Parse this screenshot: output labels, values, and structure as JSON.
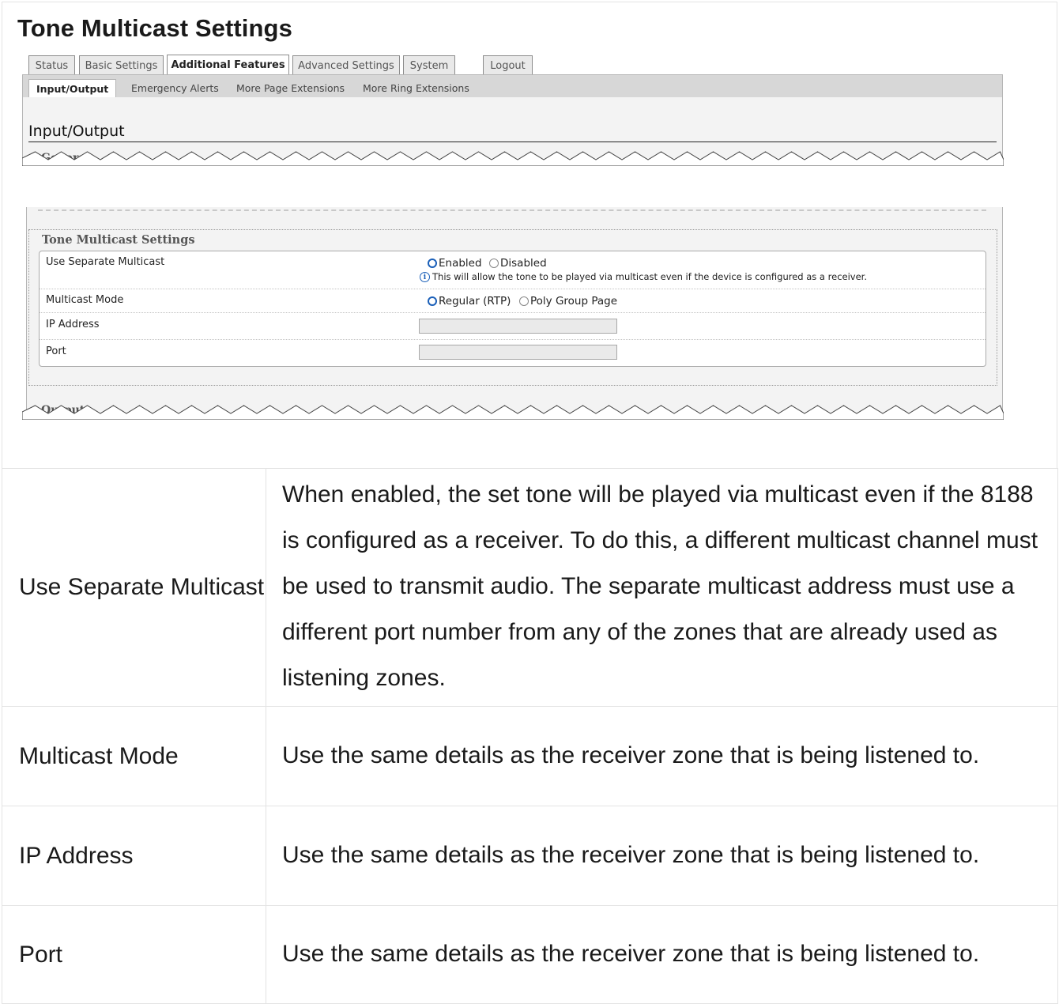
{
  "doc_title": "Tone Multicast Settings",
  "tabs": [
    {
      "label": "Status",
      "active": false
    },
    {
      "label": "Basic Settings",
      "active": false
    },
    {
      "label": "Additional Features",
      "active": true
    },
    {
      "label": "Advanced Settings",
      "active": false
    },
    {
      "label": "System",
      "active": false
    },
    {
      "label": "Logout",
      "active": false
    }
  ],
  "subtabs": [
    {
      "label": "Input/Output",
      "active": true
    },
    {
      "label": "Emergency Alerts",
      "active": false
    },
    {
      "label": "More Page Extensions",
      "active": false
    },
    {
      "label": "More Ring Extensions",
      "active": false
    }
  ],
  "section_title": "Input/Output",
  "general_legend": "General",
  "output_legend": "Output",
  "form": {
    "legend": "Tone Multicast Settings",
    "use_separate_multicast": {
      "label": "Use Separate Multicast",
      "option_enabled": "Enabled",
      "option_disabled": "Disabled",
      "selected": "Enabled",
      "note": "This will allow the tone to be played via multicast even if the device is configured as a receiver."
    },
    "multicast_mode": {
      "label": "Multicast Mode",
      "option_regular": "Regular (RTP)",
      "option_poly": "Poly Group Page",
      "selected": "Regular (RTP)"
    },
    "ip_address": {
      "label": "IP Address",
      "value": ""
    },
    "port": {
      "label": "Port",
      "value": ""
    }
  },
  "descriptions": [
    {
      "field": "Use Separate Multicast",
      "text": "When enabled, the set tone will be played via multicast even if the 8188 is configured as a receiver. To do this, a different multicast channel must be used to transmit audio. The separate multicast address must use a different port number from any of the zones that are already used as listening zones."
    },
    {
      "field": "Multicast Mode",
      "text": "Use the same details as the receiver zone that is being listened to."
    },
    {
      "field": "IP Address",
      "text": "Use the same details as the receiver zone that is being listened to."
    },
    {
      "field": "Port",
      "text": "Use the same details as the receiver zone that is being listened to."
    }
  ],
  "colors": {
    "radio_accent": "#1a5fb8",
    "panel_bg": "#f3f3f3",
    "tab_bar": "#d7d7d7"
  }
}
